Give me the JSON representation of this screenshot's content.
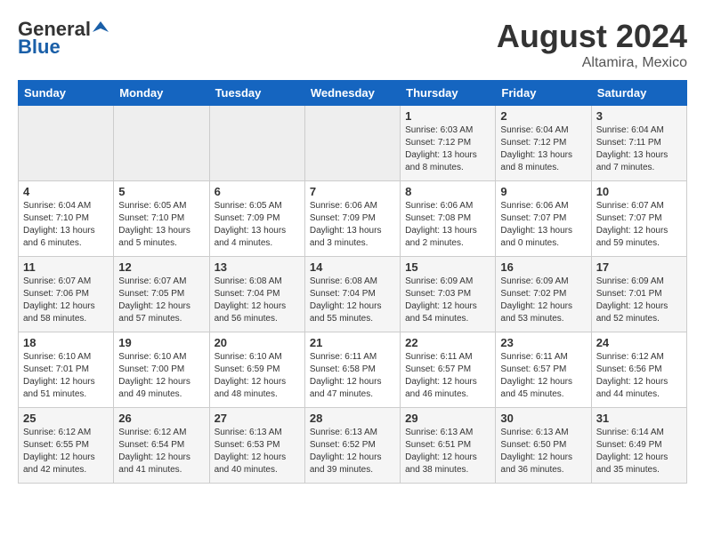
{
  "header": {
    "logo_general": "General",
    "logo_blue": "Blue",
    "month_year": "August 2024",
    "location": "Altamira, Mexico"
  },
  "days_of_week": [
    "Sunday",
    "Monday",
    "Tuesday",
    "Wednesday",
    "Thursday",
    "Friday",
    "Saturday"
  ],
  "weeks": [
    {
      "days": [
        {
          "num": "",
          "empty": true
        },
        {
          "num": "",
          "empty": true
        },
        {
          "num": "",
          "empty": true
        },
        {
          "num": "",
          "empty": true
        },
        {
          "num": "1",
          "sunrise": "6:03 AM",
          "sunset": "7:12 PM",
          "daylight": "13 hours and 8 minutes."
        },
        {
          "num": "2",
          "sunrise": "6:04 AM",
          "sunset": "7:12 PM",
          "daylight": "13 hours and 8 minutes."
        },
        {
          "num": "3",
          "sunrise": "6:04 AM",
          "sunset": "7:11 PM",
          "daylight": "13 hours and 7 minutes."
        }
      ]
    },
    {
      "days": [
        {
          "num": "4",
          "sunrise": "6:04 AM",
          "sunset": "7:10 PM",
          "daylight": "13 hours and 6 minutes."
        },
        {
          "num": "5",
          "sunrise": "6:05 AM",
          "sunset": "7:10 PM",
          "daylight": "13 hours and 5 minutes."
        },
        {
          "num": "6",
          "sunrise": "6:05 AM",
          "sunset": "7:09 PM",
          "daylight": "13 hours and 4 minutes."
        },
        {
          "num": "7",
          "sunrise": "6:06 AM",
          "sunset": "7:09 PM",
          "daylight": "13 hours and 3 minutes."
        },
        {
          "num": "8",
          "sunrise": "6:06 AM",
          "sunset": "7:08 PM",
          "daylight": "13 hours and 2 minutes."
        },
        {
          "num": "9",
          "sunrise": "6:06 AM",
          "sunset": "7:07 PM",
          "daylight": "13 hours and 0 minutes."
        },
        {
          "num": "10",
          "sunrise": "6:07 AM",
          "sunset": "7:07 PM",
          "daylight": "12 hours and 59 minutes."
        }
      ]
    },
    {
      "days": [
        {
          "num": "11",
          "sunrise": "6:07 AM",
          "sunset": "7:06 PM",
          "daylight": "12 hours and 58 minutes."
        },
        {
          "num": "12",
          "sunrise": "6:07 AM",
          "sunset": "7:05 PM",
          "daylight": "12 hours and 57 minutes."
        },
        {
          "num": "13",
          "sunrise": "6:08 AM",
          "sunset": "7:04 PM",
          "daylight": "12 hours and 56 minutes."
        },
        {
          "num": "14",
          "sunrise": "6:08 AM",
          "sunset": "7:04 PM",
          "daylight": "12 hours and 55 minutes."
        },
        {
          "num": "15",
          "sunrise": "6:09 AM",
          "sunset": "7:03 PM",
          "daylight": "12 hours and 54 minutes."
        },
        {
          "num": "16",
          "sunrise": "6:09 AM",
          "sunset": "7:02 PM",
          "daylight": "12 hours and 53 minutes."
        },
        {
          "num": "17",
          "sunrise": "6:09 AM",
          "sunset": "7:01 PM",
          "daylight": "12 hours and 52 minutes."
        }
      ]
    },
    {
      "days": [
        {
          "num": "18",
          "sunrise": "6:10 AM",
          "sunset": "7:01 PM",
          "daylight": "12 hours and 51 minutes."
        },
        {
          "num": "19",
          "sunrise": "6:10 AM",
          "sunset": "7:00 PM",
          "daylight": "12 hours and 49 minutes."
        },
        {
          "num": "20",
          "sunrise": "6:10 AM",
          "sunset": "6:59 PM",
          "daylight": "12 hours and 48 minutes."
        },
        {
          "num": "21",
          "sunrise": "6:11 AM",
          "sunset": "6:58 PM",
          "daylight": "12 hours and 47 minutes."
        },
        {
          "num": "22",
          "sunrise": "6:11 AM",
          "sunset": "6:57 PM",
          "daylight": "12 hours and 46 minutes."
        },
        {
          "num": "23",
          "sunrise": "6:11 AM",
          "sunset": "6:57 PM",
          "daylight": "12 hours and 45 minutes."
        },
        {
          "num": "24",
          "sunrise": "6:12 AM",
          "sunset": "6:56 PM",
          "daylight": "12 hours and 44 minutes."
        }
      ]
    },
    {
      "days": [
        {
          "num": "25",
          "sunrise": "6:12 AM",
          "sunset": "6:55 PM",
          "daylight": "12 hours and 42 minutes."
        },
        {
          "num": "26",
          "sunrise": "6:12 AM",
          "sunset": "6:54 PM",
          "daylight": "12 hours and 41 minutes."
        },
        {
          "num": "27",
          "sunrise": "6:13 AM",
          "sunset": "6:53 PM",
          "daylight": "12 hours and 40 minutes."
        },
        {
          "num": "28",
          "sunrise": "6:13 AM",
          "sunset": "6:52 PM",
          "daylight": "12 hours and 39 minutes."
        },
        {
          "num": "29",
          "sunrise": "6:13 AM",
          "sunset": "6:51 PM",
          "daylight": "12 hours and 38 minutes."
        },
        {
          "num": "30",
          "sunrise": "6:13 AM",
          "sunset": "6:50 PM",
          "daylight": "12 hours and 36 minutes."
        },
        {
          "num": "31",
          "sunrise": "6:14 AM",
          "sunset": "6:49 PM",
          "daylight": "12 hours and 35 minutes."
        }
      ]
    }
  ]
}
